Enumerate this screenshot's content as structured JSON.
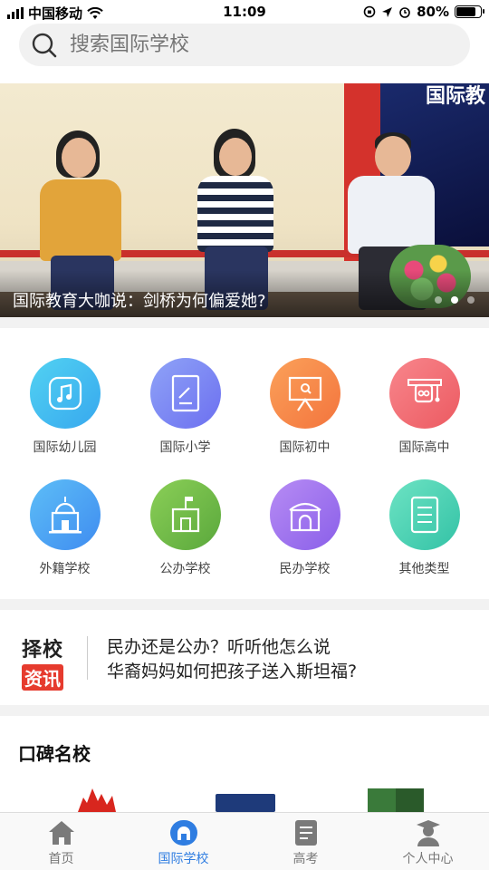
{
  "status_bar": {
    "carrier": "中国移动",
    "time": "11:09",
    "battery": "80%",
    "battery_level": 0.8
  },
  "search": {
    "placeholder": "搜索国际学校",
    "icon": "search-icon"
  },
  "banner": {
    "screen_text": "国际教",
    "caption": "国际教育大咖说：剑桥为何偏爱她?",
    "slide_count": 3,
    "active_slide": 2
  },
  "categories": [
    {
      "label": "国际幼儿园",
      "icon": "music-note-icon",
      "color_from": "#52d2f2",
      "color_to": "#37a8ee"
    },
    {
      "label": "国际小学",
      "icon": "notebook-icon",
      "color_from": "#8fa3f7",
      "color_to": "#6c6ff0"
    },
    {
      "label": "国际初中",
      "icon": "presentation-board-icon",
      "color_from": "#fba15a",
      "color_to": "#f3743d"
    },
    {
      "label": "国际高中",
      "icon": "graduation-cap-icon",
      "color_from": "#f8868c",
      "color_to": "#ec5a61"
    },
    {
      "label": "外籍学校",
      "icon": "mosque-building-icon",
      "color_from": "#5dbef7",
      "color_to": "#3f8cf0"
    },
    {
      "label": "公办学校",
      "icon": "flag-building-icon",
      "color_from": "#8bcf57",
      "color_to": "#5aa83c"
    },
    {
      "label": "民办学校",
      "icon": "arch-building-icon",
      "color_from": "#b78cf4",
      "color_to": "#8a5fe9"
    },
    {
      "label": "其他类型",
      "icon": "document-list-icon",
      "color_from": "#6de3c3",
      "color_to": "#33c2a6"
    }
  ],
  "news": {
    "logo_line1": "择校",
    "logo_line2": "资讯",
    "items": [
      "民办还是公办？听听他怎么说",
      "华裔妈妈如何把孩子送入斯坦福?"
    ]
  },
  "featured": {
    "title": "口碑名校"
  },
  "tabbar": {
    "items": [
      {
        "label": "首页",
        "icon": "home-icon",
        "active": false
      },
      {
        "label": "国际学校",
        "icon": "school-icon",
        "active": true
      },
      {
        "label": "高考",
        "icon": "document-icon",
        "active": false
      },
      {
        "label": "个人中心",
        "icon": "user-graduate-icon",
        "active": false
      }
    ]
  },
  "colors": {
    "accent": "#2f7de1",
    "news_red": "#e63b2e"
  }
}
